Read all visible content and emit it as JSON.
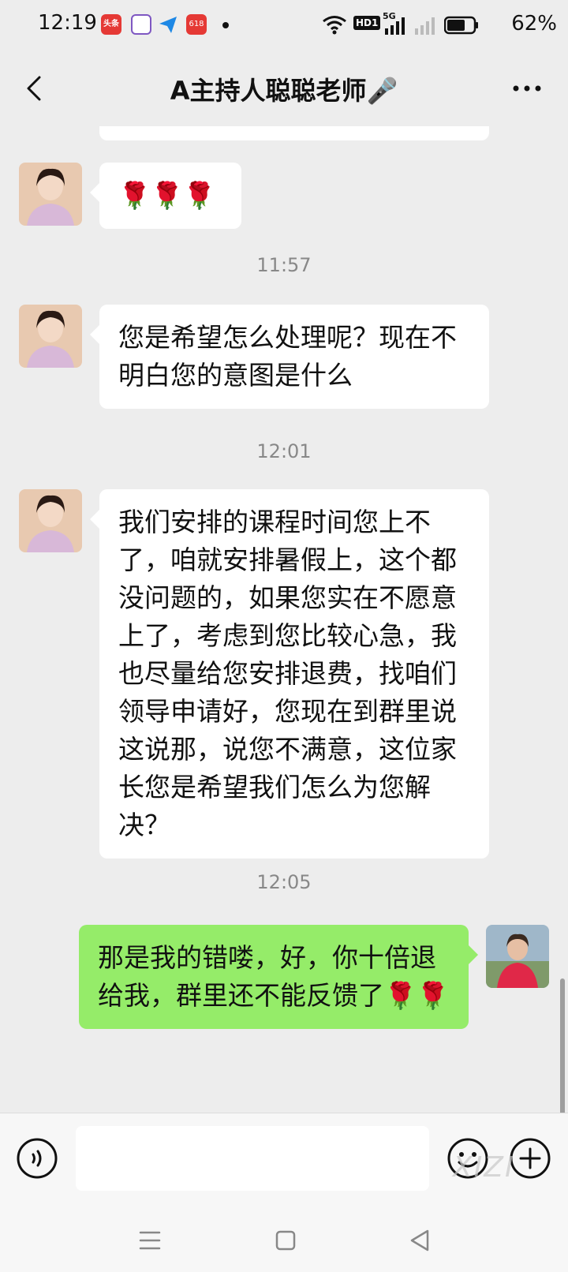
{
  "status_bar": {
    "time": "12:19",
    "notifications": [
      "头条",
      "app-icon",
      "send-icon",
      "618"
    ],
    "network": "5G",
    "hd": "HD1",
    "battery_percent": "62%"
  },
  "header": {
    "title": "A主持人聪聪老师🎤"
  },
  "messages": [
    {
      "side": "left",
      "text": "🌹🌹🌹"
    },
    {
      "timestamp": "11:57"
    },
    {
      "side": "left",
      "text": "您是希望怎么处理呢？现在不明白您的意图是什么"
    },
    {
      "timestamp": "12:01"
    },
    {
      "side": "left",
      "text": "我们安排的课程时间您上不了，咱就安排暑假上，这个都没问题的，如果您实在不愿意上了，考虑到您比较心急，我也尽量给您安排退费，找咱们领导申请好，您现在到群里说这说那，说您不满意，这位家长您是希望我们怎么为您解决？"
    },
    {
      "timestamp": "12:05"
    },
    {
      "side": "right",
      "text": "那是我的错喽，好，你十倍退给我，群里还不能反馈了🌹🌹"
    }
  ],
  "input": {
    "placeholder": ""
  },
  "watermark": "XIZI",
  "colors": {
    "background": "#ededed",
    "incoming_bubble": "#ffffff",
    "outgoing_bubble": "#95ec69"
  }
}
